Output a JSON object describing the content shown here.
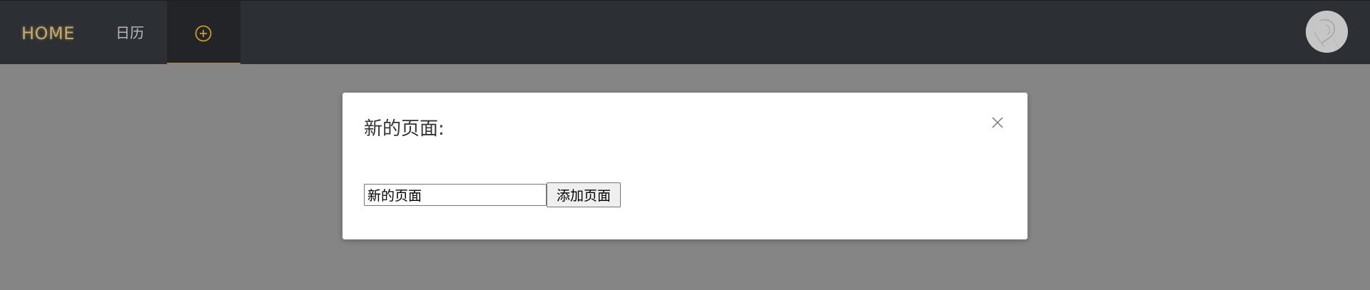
{
  "nav": {
    "home_label": "HOME",
    "calendar_label": "日历",
    "add_tab_icon": "plus-circle-icon",
    "accent_color": "#a8882f"
  },
  "user": {
    "avatar_icon": "avatar-image"
  },
  "modal": {
    "title": "新的页面:",
    "close_icon": "close-icon",
    "input_value": "新的页面",
    "submit_label": "添加页面"
  }
}
